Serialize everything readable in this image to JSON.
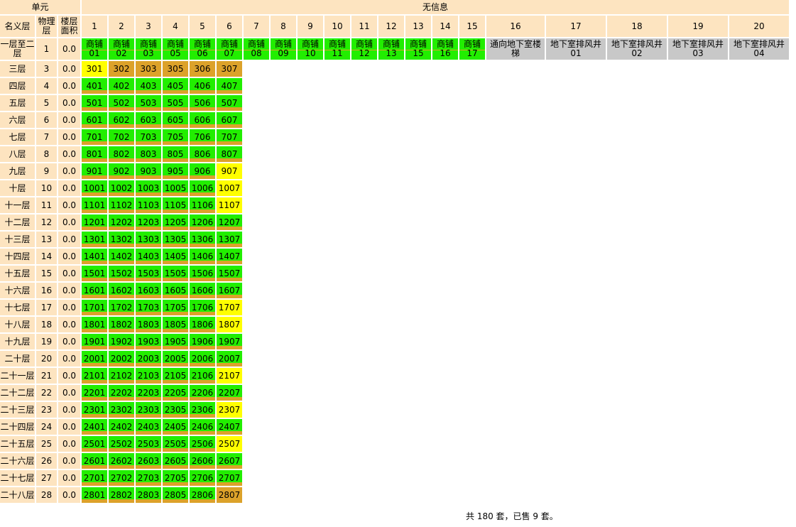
{
  "header": {
    "unit_label": "单元",
    "no_info": "无信息",
    "nominal_floor": "名义层",
    "physical_floor": "物理层",
    "floor_area": "楼层面积",
    "columns": [
      "1",
      "2",
      "3",
      "4",
      "5",
      "6",
      "7",
      "8",
      "9",
      "10",
      "11",
      "12",
      "13",
      "14",
      "15",
      "16",
      "17",
      "18",
      "19",
      "20"
    ]
  },
  "legend_colors": {
    "header_bg": "#fde4c0",
    "sold": "#dca22a",
    "available": "#22ee00",
    "reserved": "#ffff00",
    "no_info": "#c8c8c8"
  },
  "shop_row": {
    "nominal": "一层至二层",
    "physical": "1",
    "area": "0.0",
    "units": [
      {
        "label": "商铺01",
        "status": "shop"
      },
      {
        "label": "商铺02",
        "status": "shop"
      },
      {
        "label": "商铺03",
        "status": "shop"
      },
      {
        "label": "商铺05",
        "status": "shop"
      },
      {
        "label": "商铺06",
        "status": "shop"
      },
      {
        "label": "商铺07",
        "status": "shop"
      },
      {
        "label": "商铺08",
        "status": "shop"
      },
      {
        "label": "商铺09",
        "status": "shop"
      },
      {
        "label": "商铺10",
        "status": "shop"
      },
      {
        "label": "商铺11",
        "status": "shop"
      },
      {
        "label": "商铺12",
        "status": "shop"
      },
      {
        "label": "商铺13",
        "status": "shop"
      },
      {
        "label": "商铺15",
        "status": "shop"
      },
      {
        "label": "商铺16",
        "status": "shop"
      },
      {
        "label": "商铺17",
        "status": "shop"
      },
      {
        "label": "通向地下室楼梯",
        "status": "grey"
      },
      {
        "label": "地下室排风井01",
        "status": "grey"
      },
      {
        "label": "地下室排风井02",
        "status": "grey"
      },
      {
        "label": "地下室排风井03",
        "status": "grey"
      },
      {
        "label": "地下室排风井04",
        "status": "grey"
      }
    ]
  },
  "rows": [
    {
      "nominal": "三层",
      "physical": "3",
      "area": "0.0",
      "units": [
        [
          "301",
          "res"
        ],
        [
          "302",
          "sold"
        ],
        [
          "303",
          "sold"
        ],
        [
          "305",
          "sold"
        ],
        [
          "306",
          "sold"
        ],
        [
          "307",
          "sold"
        ]
      ]
    },
    {
      "nominal": "四层",
      "physical": "4",
      "area": "0.0",
      "units": [
        [
          "401",
          "avail"
        ],
        [
          "402",
          "avail"
        ],
        [
          "403",
          "avail"
        ],
        [
          "405",
          "avail"
        ],
        [
          "406",
          "avail"
        ],
        [
          "407",
          "avail"
        ]
      ]
    },
    {
      "nominal": "五层",
      "physical": "5",
      "area": "0.0",
      "units": [
        [
          "501",
          "avail"
        ],
        [
          "502",
          "avail"
        ],
        [
          "503",
          "avail"
        ],
        [
          "505",
          "avail"
        ],
        [
          "506",
          "avail"
        ],
        [
          "507",
          "avail"
        ]
      ]
    },
    {
      "nominal": "六层",
      "physical": "6",
      "area": "0.0",
      "units": [
        [
          "601",
          "avail"
        ],
        [
          "602",
          "avail"
        ],
        [
          "603",
          "avail"
        ],
        [
          "605",
          "avail"
        ],
        [
          "606",
          "avail"
        ],
        [
          "607",
          "avail"
        ]
      ]
    },
    {
      "nominal": "七层",
      "physical": "7",
      "area": "0.0",
      "units": [
        [
          "701",
          "avail"
        ],
        [
          "702",
          "avail"
        ],
        [
          "703",
          "avail"
        ],
        [
          "705",
          "avail"
        ],
        [
          "706",
          "avail"
        ],
        [
          "707",
          "avail"
        ]
      ]
    },
    {
      "nominal": "八层",
      "physical": "8",
      "area": "0.0",
      "units": [
        [
          "801",
          "avail"
        ],
        [
          "802",
          "avail"
        ],
        [
          "803",
          "avail"
        ],
        [
          "805",
          "avail"
        ],
        [
          "806",
          "avail"
        ],
        [
          "807",
          "avail"
        ]
      ]
    },
    {
      "nominal": "九层",
      "physical": "9",
      "area": "0.0",
      "units": [
        [
          "901",
          "avail"
        ],
        [
          "902",
          "avail"
        ],
        [
          "903",
          "avail"
        ],
        [
          "905",
          "avail"
        ],
        [
          "906",
          "avail"
        ],
        [
          "907",
          "res"
        ]
      ]
    },
    {
      "nominal": "十层",
      "physical": "10",
      "area": "0.0",
      "units": [
        [
          "1001",
          "avail"
        ],
        [
          "1002",
          "avail"
        ],
        [
          "1003",
          "avail"
        ],
        [
          "1005",
          "avail"
        ],
        [
          "1006",
          "avail"
        ],
        [
          "1007",
          "res"
        ]
      ]
    },
    {
      "nominal": "十一层",
      "physical": "11",
      "area": "0.0",
      "units": [
        [
          "1101",
          "avail"
        ],
        [
          "1102",
          "avail"
        ],
        [
          "1103",
          "avail"
        ],
        [
          "1105",
          "avail"
        ],
        [
          "1106",
          "avail"
        ],
        [
          "1107",
          "res"
        ]
      ]
    },
    {
      "nominal": "十二层",
      "physical": "12",
      "area": "0.0",
      "units": [
        [
          "1201",
          "avail"
        ],
        [
          "1202",
          "avail"
        ],
        [
          "1203",
          "avail"
        ],
        [
          "1205",
          "avail"
        ],
        [
          "1206",
          "avail"
        ],
        [
          "1207",
          "avail"
        ]
      ]
    },
    {
      "nominal": "十三层",
      "physical": "13",
      "area": "0.0",
      "units": [
        [
          "1301",
          "avail"
        ],
        [
          "1302",
          "avail"
        ],
        [
          "1303",
          "avail"
        ],
        [
          "1305",
          "avail"
        ],
        [
          "1306",
          "avail"
        ],
        [
          "1307",
          "avail"
        ]
      ]
    },
    {
      "nominal": "十四层",
      "physical": "14",
      "area": "0.0",
      "units": [
        [
          "1401",
          "avail"
        ],
        [
          "1402",
          "avail"
        ],
        [
          "1403",
          "avail"
        ],
        [
          "1405",
          "avail"
        ],
        [
          "1406",
          "avail"
        ],
        [
          "1407",
          "avail"
        ]
      ]
    },
    {
      "nominal": "十五层",
      "physical": "15",
      "area": "0.0",
      "units": [
        [
          "1501",
          "avail"
        ],
        [
          "1502",
          "avail"
        ],
        [
          "1503",
          "avail"
        ],
        [
          "1505",
          "avail"
        ],
        [
          "1506",
          "avail"
        ],
        [
          "1507",
          "avail"
        ]
      ]
    },
    {
      "nominal": "十六层",
      "physical": "16",
      "area": "0.0",
      "units": [
        [
          "1601",
          "avail"
        ],
        [
          "1602",
          "avail"
        ],
        [
          "1603",
          "avail"
        ],
        [
          "1605",
          "avail"
        ],
        [
          "1606",
          "avail"
        ],
        [
          "1607",
          "avail"
        ]
      ]
    },
    {
      "nominal": "十七层",
      "physical": "17",
      "area": "0.0",
      "units": [
        [
          "1701",
          "avail"
        ],
        [
          "1702",
          "avail"
        ],
        [
          "1703",
          "avail"
        ],
        [
          "1705",
          "avail"
        ],
        [
          "1706",
          "avail"
        ],
        [
          "1707",
          "res"
        ]
      ]
    },
    {
      "nominal": "十八层",
      "physical": "18",
      "area": "0.0",
      "units": [
        [
          "1801",
          "avail"
        ],
        [
          "1802",
          "avail"
        ],
        [
          "1803",
          "avail"
        ],
        [
          "1805",
          "avail"
        ],
        [
          "1806",
          "avail"
        ],
        [
          "1807",
          "res"
        ]
      ]
    },
    {
      "nominal": "十九层",
      "physical": "19",
      "area": "0.0",
      "units": [
        [
          "1901",
          "avail"
        ],
        [
          "1902",
          "avail"
        ],
        [
          "1903",
          "avail"
        ],
        [
          "1905",
          "avail"
        ],
        [
          "1906",
          "avail"
        ],
        [
          "1907",
          "avail"
        ]
      ]
    },
    {
      "nominal": "二十层",
      "physical": "20",
      "area": "0.0",
      "units": [
        [
          "2001",
          "avail"
        ],
        [
          "2002",
          "avail"
        ],
        [
          "2003",
          "avail"
        ],
        [
          "2005",
          "avail"
        ],
        [
          "2006",
          "avail"
        ],
        [
          "2007",
          "avail"
        ]
      ]
    },
    {
      "nominal": "二十一层",
      "physical": "21",
      "area": "0.0",
      "units": [
        [
          "2101",
          "avail"
        ],
        [
          "2102",
          "avail"
        ],
        [
          "2103",
          "avail"
        ],
        [
          "2105",
          "avail"
        ],
        [
          "2106",
          "avail"
        ],
        [
          "2107",
          "res"
        ]
      ]
    },
    {
      "nominal": "二十二层",
      "physical": "22",
      "area": "0.0",
      "units": [
        [
          "2201",
          "avail"
        ],
        [
          "2202",
          "avail"
        ],
        [
          "2203",
          "avail"
        ],
        [
          "2205",
          "avail"
        ],
        [
          "2206",
          "avail"
        ],
        [
          "2207",
          "avail"
        ]
      ]
    },
    {
      "nominal": "二十三层",
      "physical": "23",
      "area": "0.0",
      "units": [
        [
          "2301",
          "avail"
        ],
        [
          "2302",
          "avail"
        ],
        [
          "2303",
          "avail"
        ],
        [
          "2305",
          "avail"
        ],
        [
          "2306",
          "avail"
        ],
        [
          "2307",
          "res"
        ]
      ]
    },
    {
      "nominal": "二十四层",
      "physical": "24",
      "area": "0.0",
      "units": [
        [
          "2401",
          "avail"
        ],
        [
          "2402",
          "avail"
        ],
        [
          "2403",
          "avail"
        ],
        [
          "2405",
          "avail"
        ],
        [
          "2406",
          "avail"
        ],
        [
          "2407",
          "avail"
        ]
      ]
    },
    {
      "nominal": "二十五层",
      "physical": "25",
      "area": "0.0",
      "units": [
        [
          "2501",
          "avail"
        ],
        [
          "2502",
          "avail"
        ],
        [
          "2503",
          "avail"
        ],
        [
          "2505",
          "avail"
        ],
        [
          "2506",
          "avail"
        ],
        [
          "2507",
          "res"
        ]
      ]
    },
    {
      "nominal": "二十六层",
      "physical": "26",
      "area": "0.0",
      "units": [
        [
          "2601",
          "avail"
        ],
        [
          "2602",
          "avail"
        ],
        [
          "2603",
          "avail"
        ],
        [
          "2605",
          "avail"
        ],
        [
          "2606",
          "avail"
        ],
        [
          "2607",
          "avail"
        ]
      ]
    },
    {
      "nominal": "二十七层",
      "physical": "27",
      "area": "0.0",
      "units": [
        [
          "2701",
          "avail"
        ],
        [
          "2702",
          "avail"
        ],
        [
          "2703",
          "avail"
        ],
        [
          "2705",
          "avail"
        ],
        [
          "2706",
          "avail"
        ],
        [
          "2707",
          "avail"
        ]
      ]
    },
    {
      "nominal": "二十八层",
      "physical": "28",
      "area": "0.0",
      "units": [
        [
          "2801",
          "avail"
        ],
        [
          "2802",
          "avail"
        ],
        [
          "2803",
          "avail"
        ],
        [
          "2805",
          "avail"
        ],
        [
          "2806",
          "avail"
        ],
        [
          "2807",
          "sold"
        ]
      ]
    }
  ],
  "summary": "共 180 套，已售 9 套。"
}
